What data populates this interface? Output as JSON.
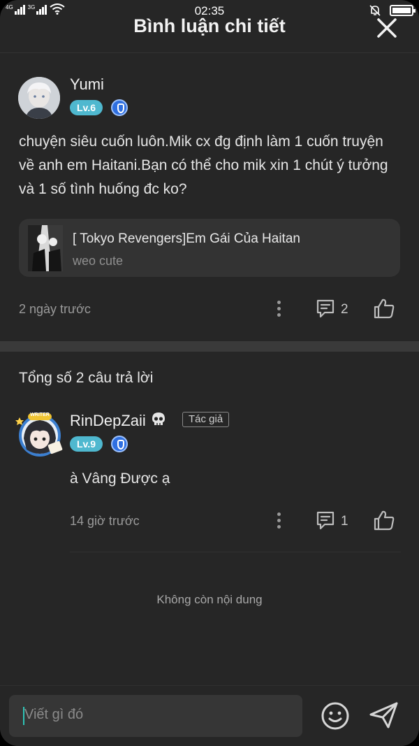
{
  "status_bar": {
    "time": "02:35",
    "signal_left": "4G",
    "signal_right": "3G"
  },
  "header": {
    "title": "Bình luận chi tiết"
  },
  "comment": {
    "username": "Yumi",
    "level": "Lv.6",
    "text": "chuyện siêu cuốn luôn.Mik cx đg định làm 1 cuốn truyện về anh em Haitani.Bạn có thể cho mik xin 1 chút ý tưởng và 1 số tình huống đc ko?",
    "story": {
      "title": "[ Tokyo Revengers]Em Gái Của Haitan",
      "subtitle": "weo cute"
    },
    "time": "2 ngày trước",
    "reply_count": "2"
  },
  "replies_header": "Tổng số 2 câu trả lời",
  "reply": {
    "username": "RinDepZaii",
    "level": "Lv.9",
    "author_tag": "Tác giả",
    "avatar_frame_text": "WRITER",
    "text": "à Vâng Được ạ",
    "time": "14 giờ trước",
    "reply_count": "1"
  },
  "end_text": "Không còn nội dung",
  "composer": {
    "placeholder": "Viết gì đó"
  },
  "colors": {
    "background": "#262626",
    "level_badge": "#4fb8cf",
    "accent_caret": "#2ec4b6"
  }
}
